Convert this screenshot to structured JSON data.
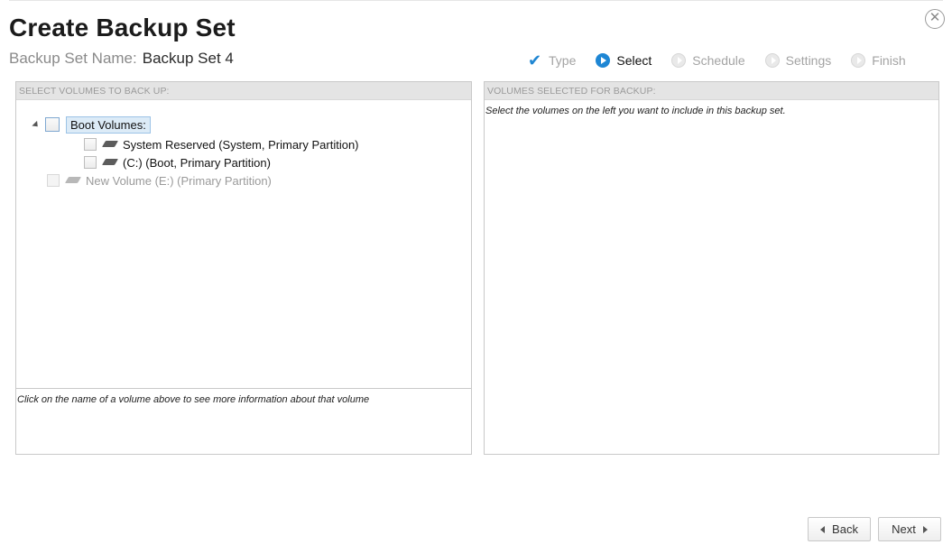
{
  "dialog": {
    "title": "Create Backup Set",
    "close_icon": "close-circle-icon",
    "backup_set_name_label": "Backup Set Name:",
    "backup_set_name": "Backup Set 4"
  },
  "wizard_steps": [
    {
      "label": "Type",
      "state": "done",
      "icon": "checkmark-icon"
    },
    {
      "label": "Select",
      "state": "current",
      "icon": "arrow-circle-icon"
    },
    {
      "label": "Schedule",
      "state": "pending",
      "icon": "arrow-circle-icon"
    },
    {
      "label": "Settings",
      "state": "pending",
      "icon": "arrow-circle-icon"
    },
    {
      "label": "Finish",
      "state": "pending",
      "icon": "arrow-circle-icon"
    }
  ],
  "left_panel": {
    "header": "SELECT VOLUMES TO BACK UP:",
    "tree": {
      "group_label": "Boot Volumes:",
      "items": [
        {
          "label": "System Reserved (System, Primary Partition)",
          "checked": false,
          "enabled": true,
          "icon": "disk-icon"
        },
        {
          "label": "(C:) (Boot, Primary Partition)",
          "checked": false,
          "enabled": true,
          "icon": "disk-icon"
        }
      ],
      "other_volume": {
        "label": "New Volume (E:) (Primary Partition)",
        "checked": false,
        "enabled": false,
        "icon": "disk-icon"
      }
    },
    "info_text": "Click on the name of a volume above to see more information about that volume"
  },
  "right_panel": {
    "header": "VOLUMES SELECTED FOR BACKUP:",
    "hint": "Select the volumes on the left you want to include in this backup set."
  },
  "buttons": {
    "back": "Back",
    "next": "Next"
  },
  "colors": {
    "accent": "#1e86d4",
    "selection_bg": "#dcebf7",
    "panel_header_bg": "#e4e4e4"
  }
}
